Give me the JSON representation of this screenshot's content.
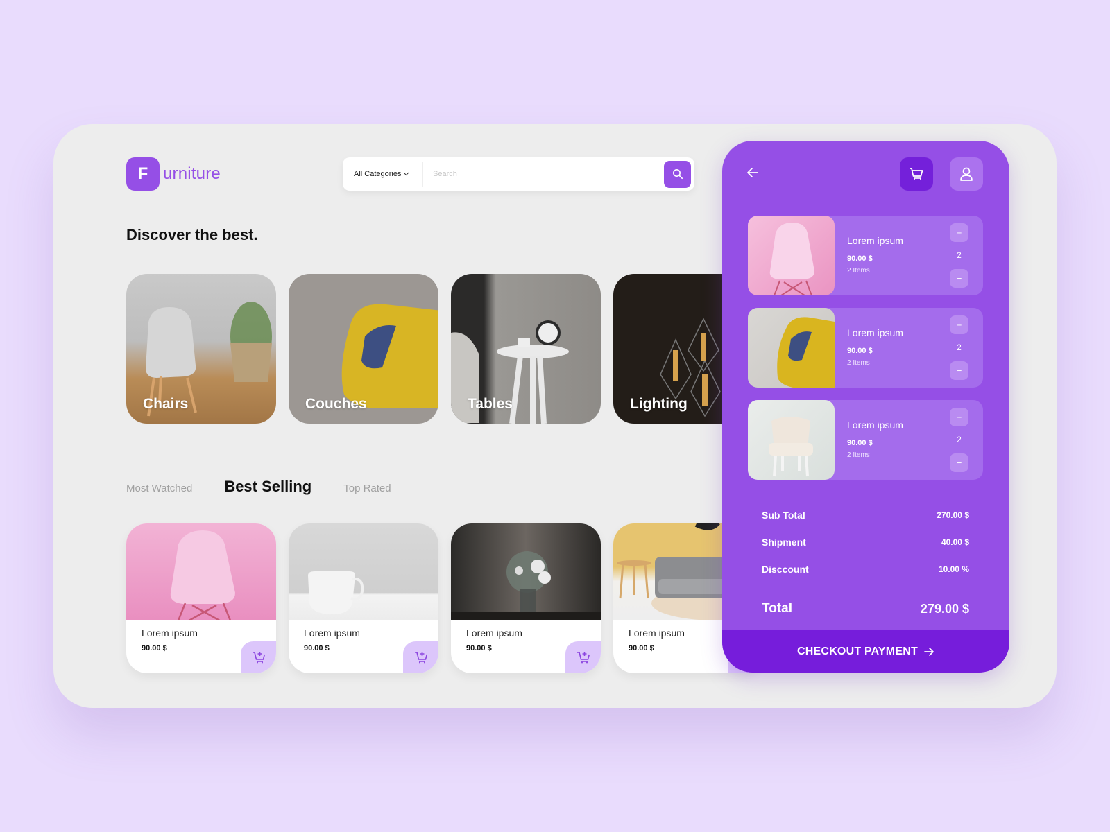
{
  "brand": {
    "mark": "F",
    "name": "urniture",
    "accent": "#954fe6",
    "accent_dark": "#761ddb"
  },
  "search": {
    "category": "All Categories",
    "placeholder": "Search",
    "value": ""
  },
  "heading": "Discover the best.",
  "categories": [
    {
      "label": "Chairs"
    },
    {
      "label": "Couches"
    },
    {
      "label": "Tables"
    },
    {
      "label": "Lighting"
    }
  ],
  "tabs": [
    {
      "label": "Most Watched",
      "active": false
    },
    {
      "label": "Best Selling",
      "active": true
    },
    {
      "label": "Top Rated",
      "active": false
    }
  ],
  "products": [
    {
      "name": "Lorem ipsum",
      "price": "90.00 $"
    },
    {
      "name": "Lorem ipsum",
      "price": "90.00 $"
    },
    {
      "name": "Lorem ipsum",
      "price": "90.00 $"
    },
    {
      "name": "Lorem ipsum",
      "price": "90.00 $"
    }
  ],
  "cart": {
    "icons": {
      "back": "arrow-left-icon",
      "cart": "cart-icon",
      "user": "user-icon"
    },
    "items": [
      {
        "name": "Lorem ipsum",
        "price": "90.00 $",
        "count_text": "2 Items",
        "qty": "2",
        "plus": "+",
        "minus": "−"
      },
      {
        "name": "Lorem ipsum",
        "price": "90.00 $",
        "count_text": "2 Items",
        "qty": "2",
        "plus": "+",
        "minus": "−"
      },
      {
        "name": "Lorem ipsum",
        "price": "90.00 $",
        "count_text": "2 Items",
        "qty": "2",
        "plus": "+",
        "minus": "−"
      }
    ],
    "summary": {
      "subtotal_label": "Sub Total",
      "subtotal": "270.00 $",
      "shipment_label": "Shipment",
      "shipment": "40.00 $",
      "discount_label": "Disccount",
      "discount": "10.00 %",
      "total_label": "Total",
      "total": "279.00 $"
    },
    "checkout_label": "CHECKOUT PAYMENT"
  }
}
